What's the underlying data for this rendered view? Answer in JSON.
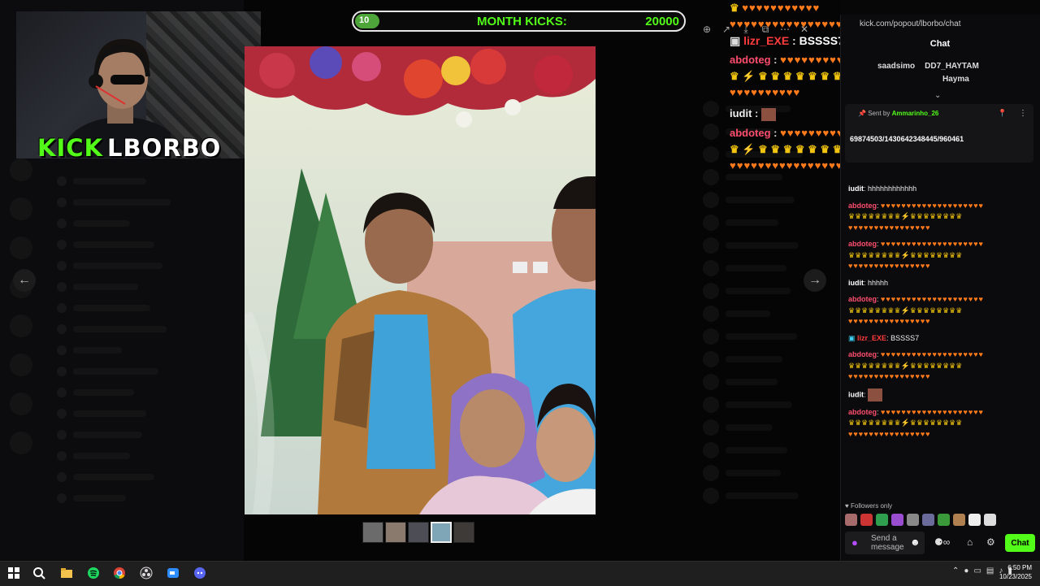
{
  "webcam": {
    "logo_kick": "KICK",
    "logo_name": "LBORBO"
  },
  "goal": {
    "label": "MONTH KICKS:",
    "value": "20000",
    "progress_fraction": 0.05
  },
  "viewer": {
    "prev_arrow": "←",
    "next_arrow": "→",
    "thumbnail_count": 5,
    "active_thumbnail": 4,
    "tools": [
      "zoom-icon",
      "share-icon",
      "download-icon",
      "open-icon",
      "more-icon",
      "close-icon"
    ]
  },
  "overlay_chat": {
    "lines": [
      {
        "user": "lizr_EXE",
        "sep": " : ",
        "text": "BSSSS7"
      },
      {
        "user": "abdoteg",
        "sep": " : ",
        "text": ""
      },
      {
        "user": "iudit",
        "sep": " : ",
        "text": ""
      },
      {
        "user": "abdoteg",
        "sep": " : ",
        "text": ""
      }
    ]
  },
  "chat_panel": {
    "url": "kick.com/popout/lborbo/chat",
    "title": "Chat",
    "top_users": [
      "saadsimo",
      "DD7_HAYTAM",
      "Hayma"
    ],
    "pinned": {
      "sent_by_label": "Sent by",
      "sent_by_user": "Ammarinho_26",
      "text": "69874503/1430642348445/960461"
    },
    "messages": [
      {
        "user": "iudit",
        "text": "hhhhhhhhhhhh",
        "color": "#ffffff"
      },
      {
        "user": "abdoteg",
        "text": "",
        "color": "#ff4d6d"
      },
      {
        "user": "abdoteg",
        "text": "",
        "color": "#ff4d6d"
      },
      {
        "user": "iudit",
        "text": "hhhhh",
        "color": "#ffffff"
      },
      {
        "user": "abdoteg",
        "text": "",
        "color": "#ff4d6d"
      },
      {
        "user": "lizr_EXE",
        "text": "BSSSS7",
        "color": "#ff3b3b"
      },
      {
        "user": "abdoteg",
        "text": "",
        "color": "#ff4d6d"
      },
      {
        "user": "iudit",
        "text": "",
        "color": "#ffffff"
      },
      {
        "user": "abdoteg",
        "text": "",
        "color": "#ff4d6d"
      }
    ],
    "followers_only": "Followers only",
    "send_placeholder": "Send a message",
    "chat_button": "Chat"
  },
  "taskbar": {
    "time": "6:50 PM",
    "date": "10/23/2025",
    "apps": [
      "windows-start-icon",
      "search-icon",
      "file-explorer-icon",
      "spotify-icon",
      "chrome-icon",
      "obs-icon",
      "zoom-app-icon",
      "discord-icon"
    ]
  },
  "colors": {
    "kick_green": "#53fc18",
    "heart_orange": "#ff7a1a",
    "username_red": "#ff4d6d"
  }
}
